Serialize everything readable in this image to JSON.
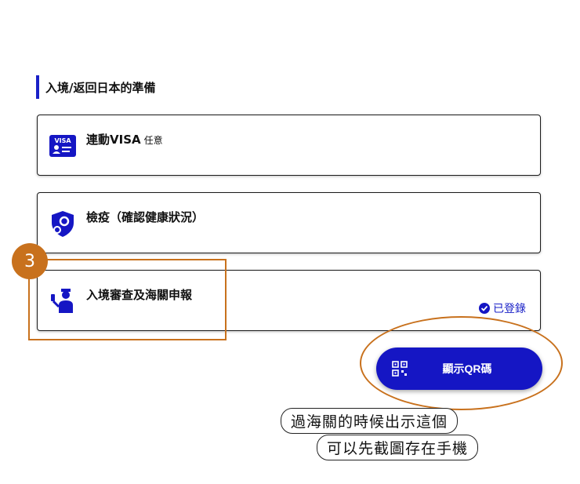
{
  "section": {
    "title": "入境/返回日本的準備"
  },
  "cards": [
    {
      "title": "連動VISA",
      "tag": "任意",
      "icon": "visa-card-icon"
    },
    {
      "title": "檢疫（確認健康狀況）",
      "icon": "shield-gear-icon"
    },
    {
      "title": "入境審查及海關申報",
      "icon": "immigration-officer-icon",
      "status": "已登錄"
    }
  ],
  "qr_button": {
    "label": "顯示QR碼",
    "icon": "qr-code-icon"
  },
  "annotation": {
    "step_number": "3",
    "note_line1": "過海關的時候出示這個",
    "note_line2": "可以先截圖存在手機",
    "accent_color": "#c8711d"
  },
  "colors": {
    "brand_blue": "#1516c4"
  }
}
